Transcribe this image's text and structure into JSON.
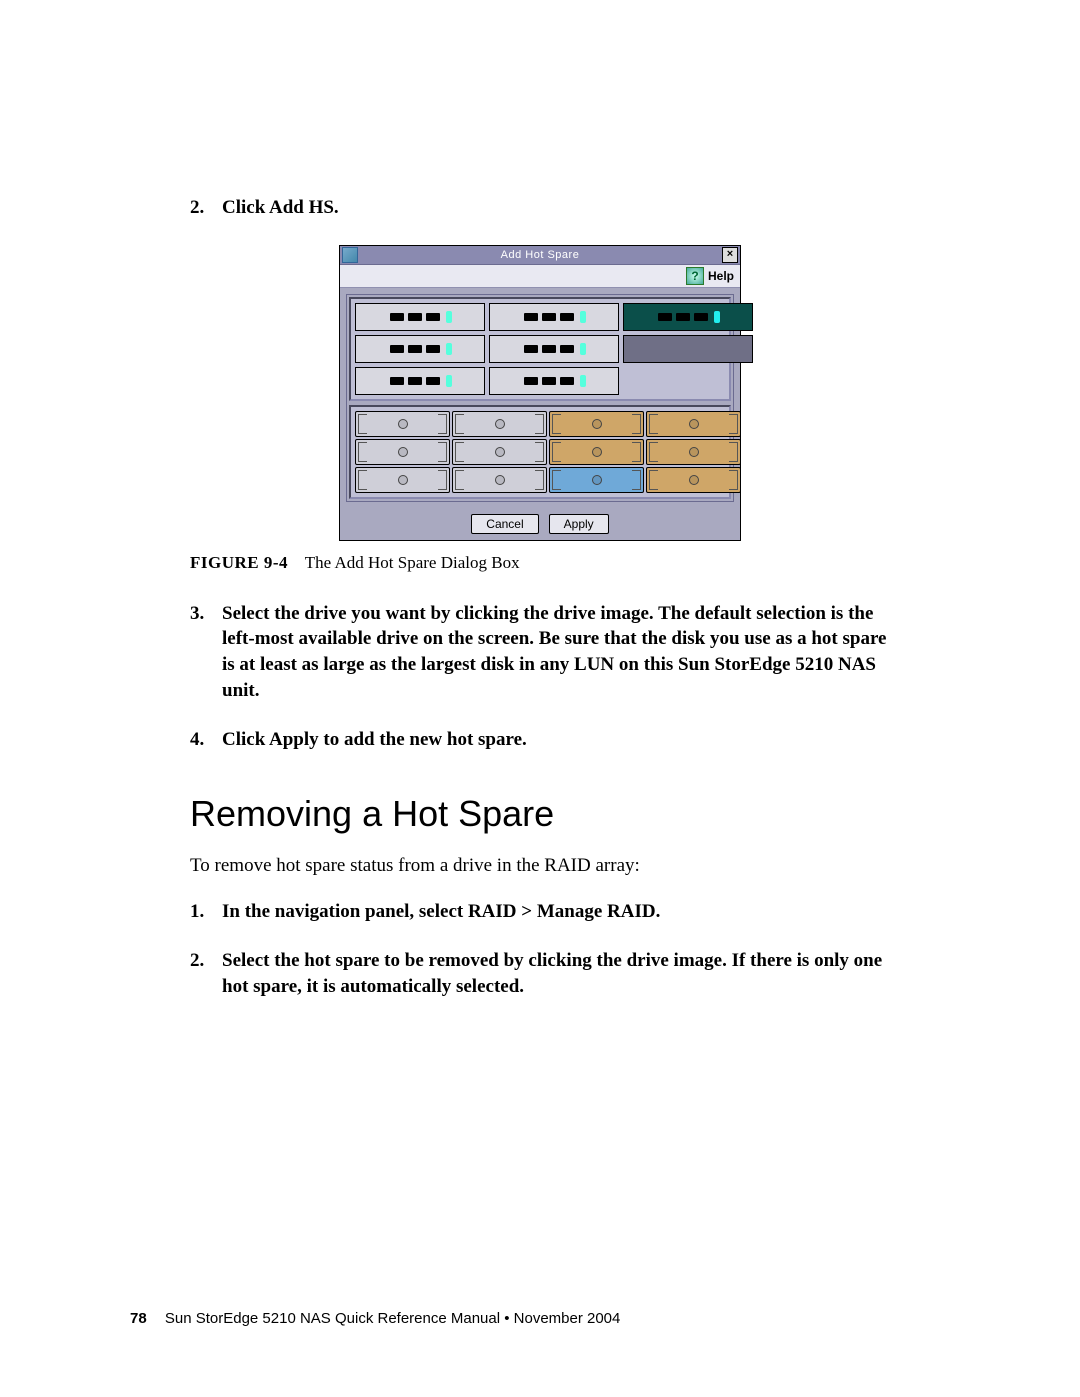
{
  "steps": {
    "s2": {
      "num": "2.",
      "text": "Click Add HS."
    },
    "s3": {
      "num": "3.",
      "text": "Select the drive you want by clicking the drive image. The default selection is the left-most available drive on the screen. Be sure that the disk you use as a hot spare is at least as large as the largest disk in any LUN on this Sun StorEdge 5210 NAS unit."
    },
    "s4": {
      "num": "4.",
      "text": "Click Apply to add the new hot spare."
    },
    "r1": {
      "num": "1.",
      "text": "In the navigation panel, select RAID > Manage RAID."
    },
    "r2": {
      "num": "2.",
      "text": "Select the hot spare to be removed by clicking the drive image. If there is only one hot spare, it is automatically selected."
    }
  },
  "dialog": {
    "title": "Add Hot Spare",
    "close": "×",
    "help": "Help",
    "cancel": "Cancel",
    "apply": "Apply"
  },
  "caption": {
    "label": "FIGURE 9-4",
    "text": "The Add Hot Spare Dialog Box"
  },
  "section": {
    "heading": "Removing a Hot Spare",
    "intro": "To remove hot spare status from a drive in the RAID array:"
  },
  "footer": {
    "page": "78",
    "text": "Sun StorEdge 5210 NAS Quick Reference Manual • November 2004"
  }
}
